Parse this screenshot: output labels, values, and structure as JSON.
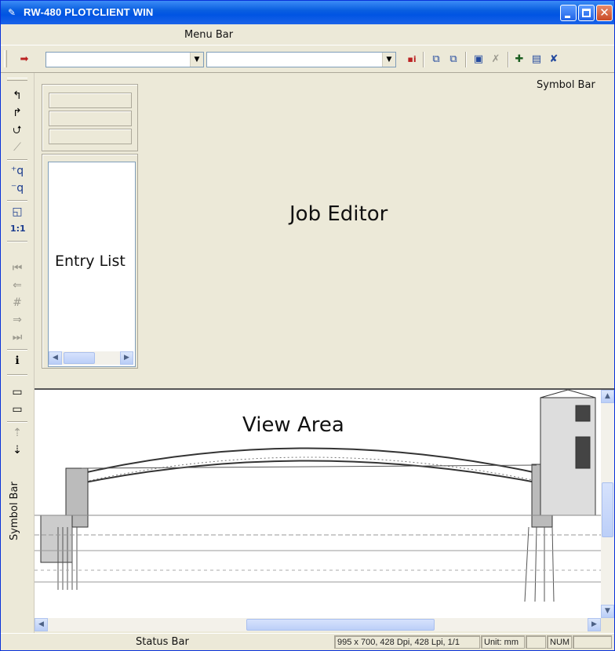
{
  "window": {
    "title": "RW-480 PLOTCLIENT WIN",
    "app_icon": "plot-app-icon"
  },
  "menubar": {
    "label": "Menu Bar"
  },
  "toolbar": {
    "combo1_value": "",
    "combo2_value": "",
    "icons": [
      "go-icon",
      "info-icon",
      "copy-icon",
      "paste-icon",
      "save-icon",
      "delete-icon",
      "add-icon",
      "edit-icon",
      "remove-icon"
    ]
  },
  "symbolbar_top": {
    "label": "Symbol Bar"
  },
  "symbolbar_left": {
    "label": "Symbol Bar",
    "icons": [
      "undo-icon",
      "redo-icon",
      "rotate-icon",
      "mirror-icon",
      "zoom-in-icon",
      "zoom-out-icon",
      "zoom-window-icon",
      "zoom-1to1-icon",
      "first-icon",
      "prev-icon",
      "page-icon",
      "next-icon",
      "last-icon",
      "info-icon",
      "window-top-icon",
      "window-bottom-icon",
      "move-up-icon",
      "move-down-icon"
    ]
  },
  "job_editor": {
    "label": "Job Editor"
  },
  "entry_list": {
    "label": "Entry List"
  },
  "view_area": {
    "label": "View Area"
  },
  "status_bar": {
    "label": "Status Bar",
    "info": "995 x 700, 428 Dpi, 428 Lpi, 1/1",
    "unit": "Unit: mm",
    "num": "NUM"
  },
  "colors": {
    "titlebar": "#0054e3",
    "face": "#ece9d8",
    "accent": "#0831d9"
  }
}
